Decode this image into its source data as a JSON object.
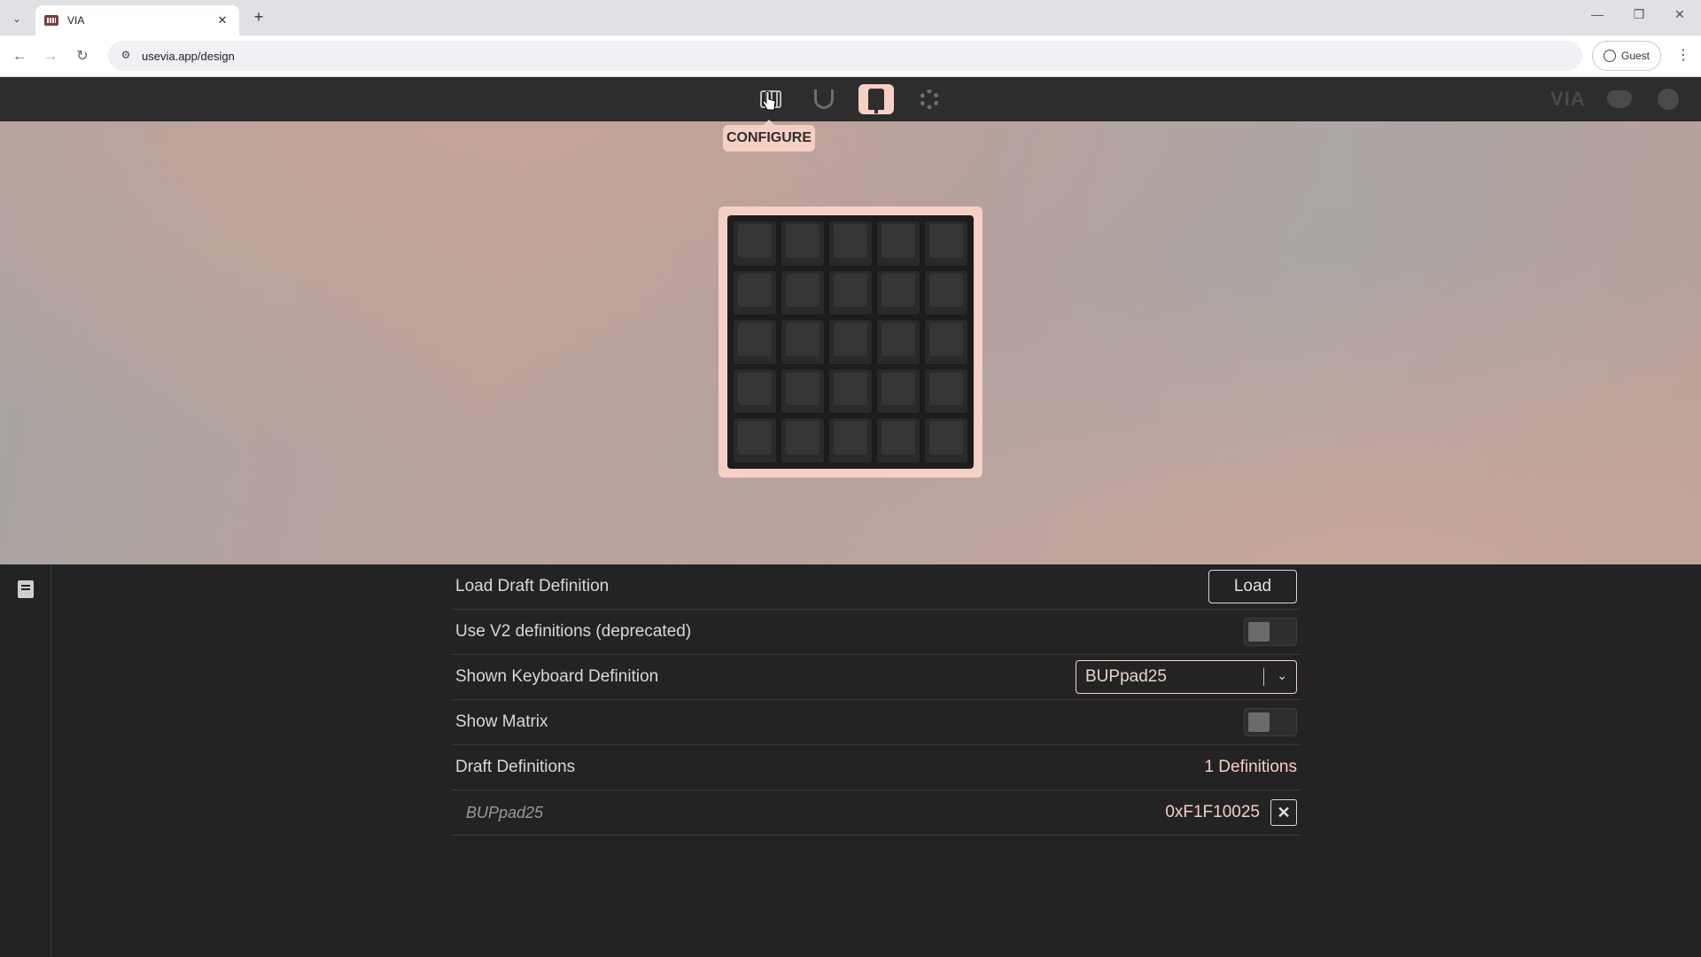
{
  "browser": {
    "tab_title": "VIA",
    "tab_close": "✕",
    "new_tab": "+",
    "url": "usevia.app/design",
    "profile_label": "Guest",
    "window_minimize": "—",
    "window_restore": "❐",
    "window_close": "✕"
  },
  "app": {
    "brand": "VIA",
    "tooltip": "CONFIGURE",
    "nav": [
      "configure-icon",
      "test-icon",
      "design-icon",
      "settings-icon"
    ],
    "accent": "#f6cfc5"
  },
  "keyboard": {
    "rows": 5,
    "cols": 5
  },
  "design": {
    "rows": [
      {
        "label": "Load Draft Definition",
        "button": "Load"
      },
      {
        "label": "Use V2 definitions (deprecated)",
        "toggle": false
      },
      {
        "label": "Shown Keyboard Definition",
        "select_value": "BUPpad25"
      },
      {
        "label": "Show Matrix",
        "toggle": false
      },
      {
        "label": "Draft Definitions",
        "count": "1 Definitions"
      },
      {
        "label": "BUPpad25",
        "vendor_id": "0xF1F10025",
        "remove": "✕"
      }
    ]
  }
}
